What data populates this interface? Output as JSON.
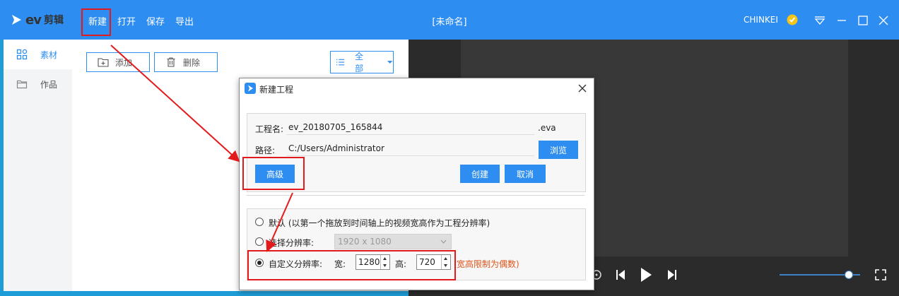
{
  "app": {
    "brand_ev": "ev",
    "brand_cn": "剪辑",
    "menu": [
      "新建",
      "打开",
      "保存",
      "导出"
    ],
    "doc_title": "[未命名]",
    "user_name": "CHINKEI",
    "window_controls": [
      "dropdown-icon",
      "minimize-icon",
      "maximize-icon",
      "close-icon"
    ]
  },
  "sidebar": {
    "items": [
      {
        "label": "素材",
        "icon": "material-grid-icon",
        "active": true
      },
      {
        "label": "作品",
        "icon": "folder-icon",
        "active": false
      }
    ]
  },
  "toolbar": {
    "add_label": "添加",
    "delete_label": "删除",
    "filter_label": "全部"
  },
  "dialog": {
    "title": "新建工程",
    "project_name_label": "工程名:",
    "project_name_value": "ev_20180705_165844",
    "project_ext": ".eva",
    "path_label": "路径:",
    "path_value": "C:/Users/Administrator",
    "browse_label": "浏览",
    "advanced_label": "高级",
    "create_label": "创建",
    "cancel_label": "取消",
    "option_default": "默认 (以第一个拖放到时间轴上的视频宽高作为工程分辨率)",
    "option_select": "选择分辨率:",
    "select_value": "1920 x 1080",
    "option_custom": "自定义分辨率:",
    "width_label": "宽:",
    "width_value": "1280",
    "height_label": "高:",
    "height_value": "720",
    "note": "宽高限制为偶数)",
    "selected_option": "custom"
  },
  "player": {
    "volume_level": 0.86
  },
  "colors": {
    "accent": "#2e8df0",
    "annotation": "#e31a1c",
    "note": "#e0541a"
  }
}
